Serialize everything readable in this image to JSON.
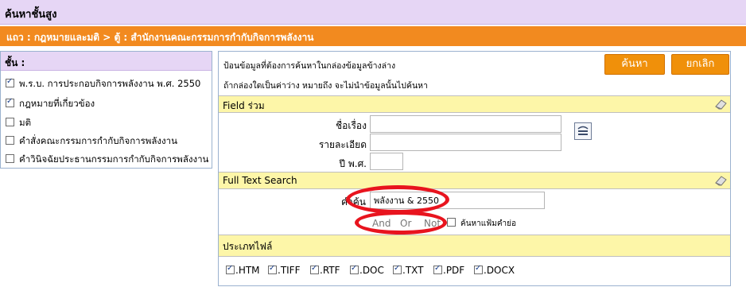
{
  "header": {
    "title": "ค้นหาชั้นสูง"
  },
  "breadcrumb": {
    "text": "แถว : กฎหมายและมติ > ตู้ : สำนักงานคณะกรรมการกำกับกิจการพลังงาน"
  },
  "sidebar": {
    "title": "ชั้น :",
    "items": [
      {
        "label": "พ.ร.บ. การประกอบกิจการพลังงาน พ.ศ. 2550",
        "checked": true
      },
      {
        "label": "กฎหมายที่เกี่ยวข้อง",
        "checked": true
      },
      {
        "label": "มติ",
        "checked": false
      },
      {
        "label": "คำสั่งคณะกรรมการกำกับกิจการพลังงาน",
        "checked": false
      },
      {
        "label": "คำวินิจฉัยประธานกรรมการกำกับกิจการพลังงาน",
        "checked": false
      }
    ]
  },
  "main": {
    "instructions": [
      "ป้อนข้อมูลที่ต้องการค้นหาในกล่องข้อมูลข้างล่าง",
      "ถ้ากล่องใดเป็นค่าว่าง หมายถึง จะไม่นำข้อมูลนั้นไปค้นหา"
    ],
    "search_button": "ค้นหา",
    "cancel_button": "ยกเลิก",
    "field_section": {
      "title": "Field ร่วม",
      "subject_label": "ชื่อเรื่อง",
      "subject_value": "",
      "detail_label": "รายละเอียด",
      "detail_value": "",
      "year_label": "ปี พ.ศ.",
      "year_value": ""
    },
    "fulltext_section": {
      "title": "Full Text Search",
      "word_label": "คำค้น",
      "word_value": "พลังงาน & 2550",
      "ops": [
        "And",
        "Or",
        "Not"
      ],
      "search_summary_label": "ค้นหาแฟ้มคำย่อ",
      "search_summary_checked": false
    },
    "filetype_section": {
      "title": "ประเภทไฟล์",
      "types": [
        ".HTM",
        ".TIFF",
        ".RTF",
        ".DOC",
        ".TXT",
        ".PDF",
        ".DOCX"
      ]
    }
  },
  "colors": {
    "header_bg": "#e6d6f5",
    "breadcrumb_bg": "#f28a1f",
    "button_bg": "#f0900a",
    "section_bg": "#fdf6a8",
    "highlight_ring": "#e8141e"
  }
}
